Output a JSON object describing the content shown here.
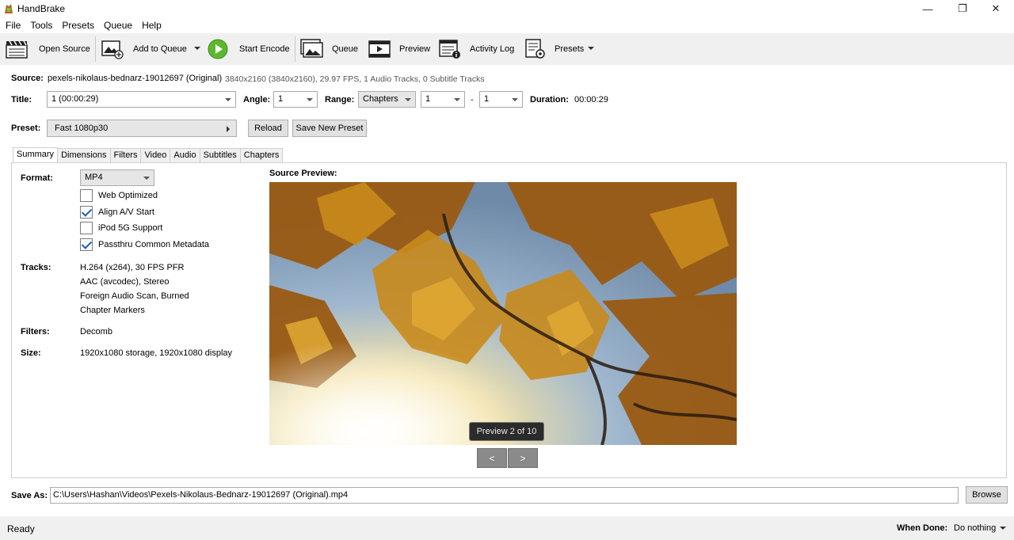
{
  "window": {
    "title": "HandBrake",
    "minimize": "—",
    "maximize": "❐",
    "close": "✕"
  },
  "menu": [
    "File",
    "Tools",
    "Presets",
    "Queue",
    "Help"
  ],
  "toolbar": {
    "open_source": "Open Source",
    "add_to_queue": "Add to Queue",
    "start_encode": "Start Encode",
    "queue": "Queue",
    "preview": "Preview",
    "activity_log": "Activity Log",
    "presets": "Presets"
  },
  "source": {
    "label": "Source:",
    "name": "pexels-nikolaus-bednarz-19012697 (Original)",
    "info": "3840x2160 (3840x2160), 29.97 FPS, 1 Audio Tracks, 0 Subtitle Tracks"
  },
  "title_row": {
    "title_label": "Title:",
    "title_value": "1  (00:00:29)",
    "angle_label": "Angle:",
    "angle_value": "1",
    "range_label": "Range:",
    "range_type": "Chapters",
    "range_start": "1",
    "range_dash": "-",
    "range_end": "1",
    "duration_label": "Duration:",
    "duration_value": "00:00:29"
  },
  "preset_row": {
    "label": "Preset:",
    "value": "Fast 1080p30",
    "reload": "Reload",
    "save_new": "Save New Preset"
  },
  "tabs": [
    "Summary",
    "Dimensions",
    "Filters",
    "Video",
    "Audio",
    "Subtitles",
    "Chapters"
  ],
  "summary": {
    "format_label": "Format:",
    "format_value": "MP4",
    "options": [
      {
        "label": "Web Optimized",
        "checked": false
      },
      {
        "label": "Align A/V Start",
        "checked": true
      },
      {
        "label": "iPod 5G Support",
        "checked": false
      },
      {
        "label": "Passthru Common Metadata",
        "checked": true
      }
    ],
    "tracks_label": "Tracks:",
    "tracks": [
      "H.264 (x264), 30 FPS PFR",
      "AAC (avcodec), Stereo",
      "Foreign Audio Scan, Burned",
      "Chapter Markers"
    ],
    "filters_label": "Filters:",
    "filters_value": "Decomb",
    "size_label": "Size:",
    "size_value": "1920x1080 storage, 1920x1080 display"
  },
  "preview": {
    "label": "Source Preview:",
    "overlay": "Preview 2 of 10",
    "prev": "<",
    "next": ">"
  },
  "save_as": {
    "label": "Save As:",
    "path": "C:\\Users\\Hashan\\Videos\\Pexels-Nikolaus-Bednarz-19012697 (Original).mp4",
    "browse": "Browse"
  },
  "status": {
    "text": "Ready",
    "when_done_label": "When Done:",
    "when_done_value": "Do nothing"
  },
  "colors": {
    "accent": "#1b5fbf",
    "play_green": "#5db82f",
    "toolbar_bg": "#f0f0f0"
  }
}
